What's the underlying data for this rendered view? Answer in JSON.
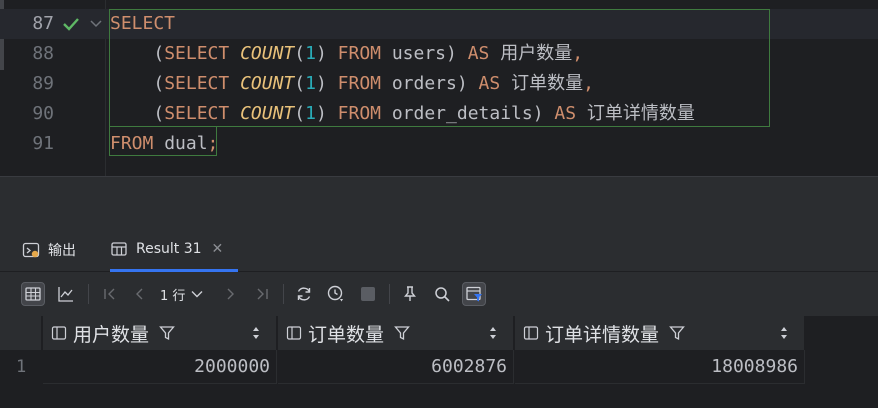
{
  "editor": {
    "lines": [
      {
        "num": "87",
        "current": true,
        "checked": true
      },
      {
        "num": "88"
      },
      {
        "num": "89"
      },
      {
        "num": "90"
      },
      {
        "num": "91"
      }
    ],
    "code": {
      "l87": {
        "kw": "SELECT"
      },
      "l88": {
        "indent": "    ",
        "open": "(",
        "select": "SELECT",
        "space1": " ",
        "fn": "COUNT",
        "p1": "(",
        "num": "1",
        "p2": ")",
        "space2": " ",
        "from": "FROM",
        "table": " users) ",
        "as": "AS",
        "alias": " 用户数量",
        "comma": ","
      },
      "l89": {
        "indent": "    ",
        "open": "(",
        "select": "SELECT",
        "space1": " ",
        "fn": "COUNT",
        "p1": "(",
        "num": "1",
        "p2": ")",
        "space2": " ",
        "from": "FROM",
        "table": " orders) ",
        "as": "AS",
        "alias": " 订单数量",
        "comma": ","
      },
      "l90": {
        "indent": "    ",
        "open": "(",
        "select": "SELECT",
        "space1": " ",
        "fn": "COUNT",
        "p1": "(",
        "num": "1",
        "p2": ")",
        "space2": " ",
        "from": "FROM",
        "table": " order_details) ",
        "as": "AS",
        "alias": " 订单详情数量"
      },
      "l91": {
        "from": "FROM",
        "rest": " dual",
        "semi": ";"
      }
    }
  },
  "tabs": {
    "output_label": "输出",
    "result_label": "Result 31",
    "close_glyph": "✕"
  },
  "toolbar": {
    "rows_label": "1 行"
  },
  "grid": {
    "columns": [
      "用户数量",
      "订单数量",
      "订单详情数量"
    ],
    "rows": [
      {
        "num": "1",
        "values": [
          "2000000",
          "6002876",
          "18008986"
        ]
      }
    ]
  },
  "colors": {
    "keyword": "#cf8e6d",
    "function": "#e8c17a",
    "number": "#2aacb8",
    "check": "#5fb865",
    "accent": "#3574f0"
  }
}
